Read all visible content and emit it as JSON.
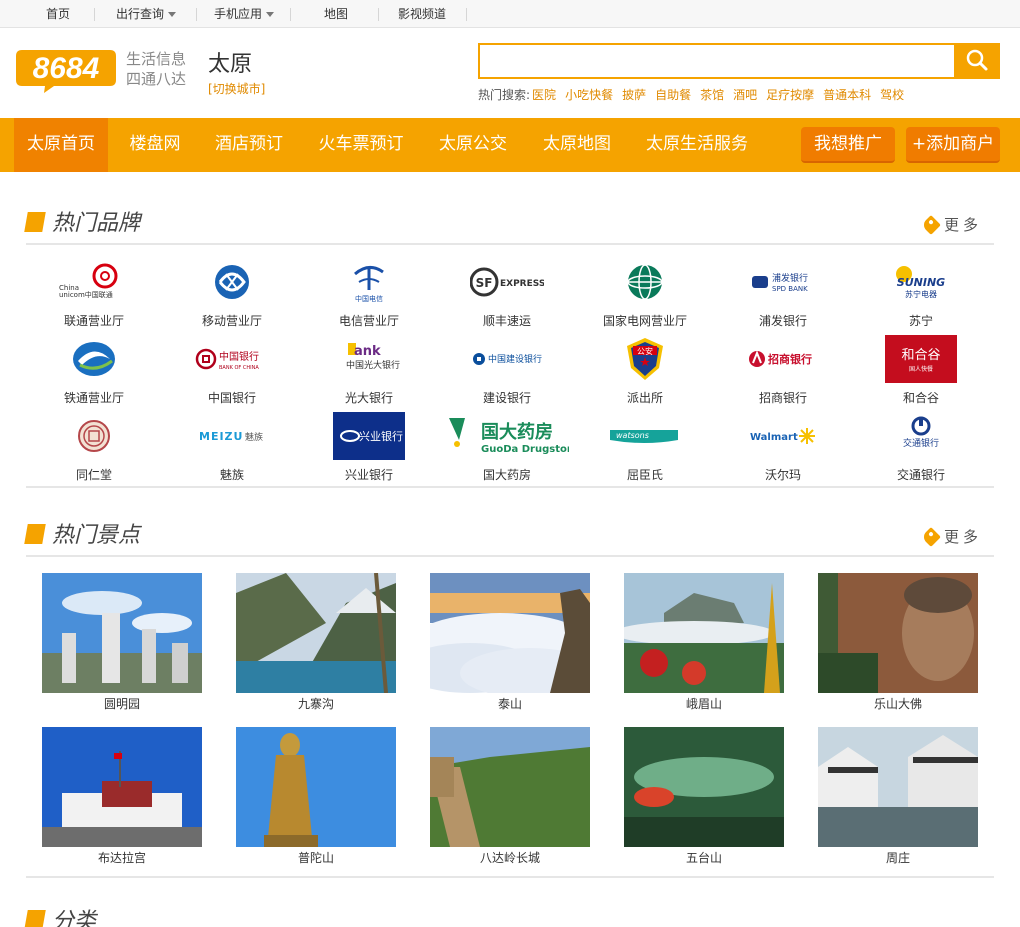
{
  "topbar": {
    "items": [
      {
        "label": "首页"
      },
      {
        "label": "出行查询"
      },
      {
        "label": "手机应用"
      },
      {
        "label": "地图"
      },
      {
        "label": "影视频道"
      }
    ]
  },
  "header": {
    "logo_text": "8684",
    "slogan_line1": "生活信息",
    "slogan_line2": "四通八达",
    "city": "太原",
    "switch_city": "[切换城市]",
    "search": {
      "value": "",
      "placeholder": ""
    },
    "hot_search_label": "热门搜索:",
    "hot_keywords": [
      "医院",
      "小吃快餐",
      "披萨",
      "自助餐",
      "茶馆",
      "酒吧",
      "足疗按摩",
      "普通本科",
      "驾校"
    ]
  },
  "nav": {
    "items": [
      {
        "label": "太原首页"
      },
      {
        "label": "楼盘网"
      },
      {
        "label": "酒店预订"
      },
      {
        "label": "火车票预订"
      },
      {
        "label": "太原公交"
      },
      {
        "label": "太原地图"
      },
      {
        "label": "太原生活服务"
      }
    ],
    "promote_label": "我想推广",
    "add_merchant_label": "+添加商户"
  },
  "brands_section": {
    "title": "热门品牌",
    "more_label": "更多",
    "brands": [
      {
        "name": "联通营业厅",
        "logo_text": "China unicom中国联通"
      },
      {
        "name": "移动营业厅",
        "logo_text": ""
      },
      {
        "name": "电信营业厅",
        "logo_text": "中国电信"
      },
      {
        "name": "顺丰速运",
        "logo_text": "EXPRESS"
      },
      {
        "name": "国家电网营业厅",
        "logo_text": ""
      },
      {
        "name": "浦发银行",
        "logo_text": "浦发银行 SPD BANK"
      },
      {
        "name": "苏宁",
        "logo_text": "SUNING 苏宁电器"
      },
      {
        "name": "铁通营业厅",
        "logo_text": ""
      },
      {
        "name": "中国银行",
        "logo_text": "中国银行 BANK OF CHINA"
      },
      {
        "name": "光大银行",
        "logo_text": "Bank 中国光大银行"
      },
      {
        "name": "建设银行",
        "logo_text": "中国建设银行"
      },
      {
        "name": "派出所",
        "logo_text": "公安"
      },
      {
        "name": "招商银行",
        "logo_text": "招商银行"
      },
      {
        "name": "和合谷",
        "logo_text": "和合谷"
      },
      {
        "name": "同仁堂",
        "logo_text": ""
      },
      {
        "name": "魅族",
        "logo_text": "MEIZU 魅族"
      },
      {
        "name": "兴业银行",
        "logo_text": "兴业银行"
      },
      {
        "name": "国大药房",
        "logo_text": "国大药房 GuoDa Drugstore"
      },
      {
        "name": "屈臣氏",
        "logo_text": "watsons"
      },
      {
        "name": "沃尔玛",
        "logo_text": "Walmart"
      },
      {
        "name": "交通银行",
        "logo_text": "交通银行"
      }
    ]
  },
  "spots_section": {
    "title": "热门景点",
    "more_label": "更多",
    "spots": [
      {
        "name": "圆明园",
        "theme": "ruins"
      },
      {
        "name": "九寨沟",
        "theme": "lake"
      },
      {
        "name": "泰山",
        "theme": "clouds"
      },
      {
        "name": "峨眉山",
        "theme": "golden"
      },
      {
        "name": "乐山大佛",
        "theme": "buddha"
      },
      {
        "name": "布达拉宫",
        "theme": "palace"
      },
      {
        "name": "普陀山",
        "theme": "statue"
      },
      {
        "name": "八达岭长城",
        "theme": "wall"
      },
      {
        "name": "五台山",
        "theme": "forest"
      },
      {
        "name": "周庄",
        "theme": "water"
      }
    ]
  },
  "category_section": {
    "title": "分类"
  },
  "colors": {
    "accent": "#f5a300",
    "accent_dark": "#f08200"
  }
}
